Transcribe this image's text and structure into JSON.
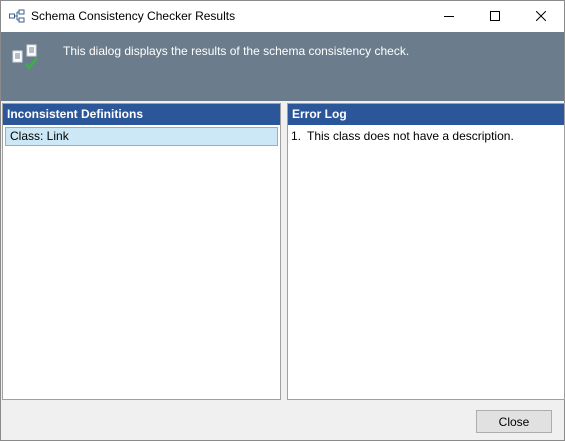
{
  "window": {
    "title": "Schema Consistency Checker Results",
    "icon": "schema-diagram-icon"
  },
  "titlebar_buttons": {
    "minimize_icon": "minimize-icon",
    "maximize_icon": "maximize-icon",
    "close_icon": "close-icon"
  },
  "banner": {
    "icon": "checked-documents-icon",
    "text": "This dialog displays the results of the schema consistency check.",
    "background": "#6b7d8c"
  },
  "inconsistent_definitions": {
    "header": "Inconsistent Definitions",
    "items": [
      {
        "label": "Class: Link",
        "selected": true
      }
    ]
  },
  "error_log": {
    "header": "Error Log",
    "entries": [
      {
        "number": "1.",
        "text": "This class does not have a description."
      }
    ]
  },
  "footer": {
    "close_label": "Close"
  },
  "colors": {
    "panel_header": "#2b579a",
    "selection": "#cce8f6",
    "selection_border": "#7eb4ea"
  }
}
